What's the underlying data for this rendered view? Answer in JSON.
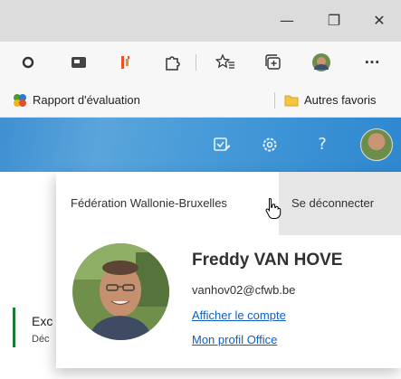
{
  "titlebar": {
    "minimize_glyph": "—",
    "restore_glyph": "❐",
    "close_glyph": "✕"
  },
  "toolbar": {
    "icons": [
      "record-icon",
      "reader-icon",
      "extension-bars-icon",
      "extensions-icon",
      "favorites-icon",
      "collections-icon",
      "profile-icon",
      "more-icon"
    ],
    "more_glyph": "···"
  },
  "favorites": {
    "item_label": "Rapport d'évaluation",
    "folder_label": "Autres favoris"
  },
  "banner": {
    "icons": [
      "task-icon",
      "settings-icon",
      "help-icon"
    ],
    "help_glyph": "?"
  },
  "background": {
    "line1": "Exc",
    "line2": "Déc"
  },
  "account_panel": {
    "organization": "Fédération Wallonie-Bruxelles",
    "sign_out": "Se déconnecter",
    "name": "Freddy VAN HOVE",
    "email": "vanhov02@cfwb.be",
    "view_account": "Afficher le compte",
    "office_profile": "Mon profil Office"
  },
  "colors": {
    "banner": "#3f8fd2",
    "link": "#0f5fc2",
    "titlebar": "#dcdcdc"
  }
}
